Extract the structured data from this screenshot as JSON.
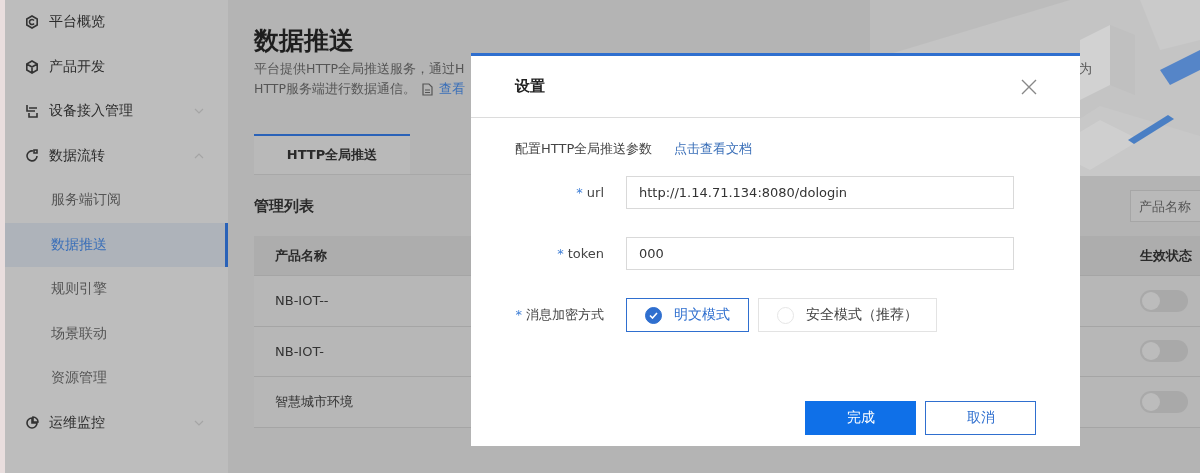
{
  "sidebar": {
    "items": [
      {
        "label": "平台概览"
      },
      {
        "label": "产品开发"
      },
      {
        "label": "设备接入管理",
        "expanded": false
      },
      {
        "label": "数据流转",
        "expanded": true,
        "children": [
          {
            "label": "服务端订阅",
            "selected": false
          },
          {
            "label": "数据推送",
            "selected": true
          },
          {
            "label": "规则引擎",
            "selected": false
          },
          {
            "label": "场景联动",
            "selected": false
          },
          {
            "label": "资源管理",
            "selected": false
          }
        ]
      },
      {
        "label": "运维监控",
        "expanded": false
      }
    ]
  },
  "page": {
    "title": "数据推送",
    "description_line_1": "平台提供HTTP全局推送服务，通过H",
    "description_line_1_end": "为",
    "description_line_2": "HTTP服务端进行数据通信。",
    "doc_link": "查看"
  },
  "tabs": [
    {
      "label": "HTTP全局推送",
      "selected": true
    }
  ],
  "list": {
    "title": "管理列表",
    "search": {
      "placeholder": "产品名称"
    },
    "columns": [
      "产品名称",
      "生效状态"
    ],
    "rows": [
      {
        "name": "NB-IOT--",
        "enabled": false
      },
      {
        "name": "NB-IOT-",
        "enabled": false
      },
      {
        "name": "智慧城市环境",
        "enabled": false
      }
    ]
  },
  "dialog": {
    "title": "设置",
    "intro": "配置HTTP全局推送参数",
    "intro_link": "点击查看文档",
    "fields": [
      {
        "label": "url",
        "required_mark": "*",
        "value": "http://1.14.71.134:8080/dologin"
      },
      {
        "label": "token",
        "required_mark": "*",
        "value": "000"
      }
    ],
    "encryption": {
      "label": "消息加密方式",
      "required_mark": "*",
      "options": [
        {
          "label": "明文模式",
          "selected": true
        },
        {
          "label": "安全模式（推荐）",
          "selected": false
        }
      ]
    },
    "buttons": [
      {
        "label": "完成",
        "kind": "primary"
      },
      {
        "label": "取消",
        "kind": "secondary"
      }
    ]
  }
}
